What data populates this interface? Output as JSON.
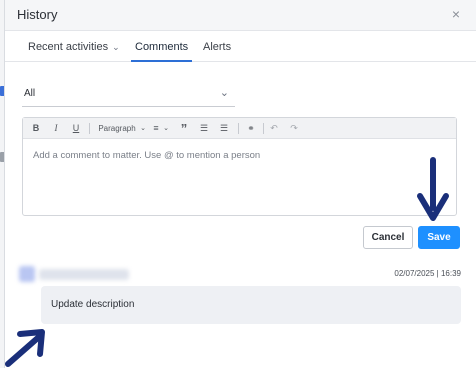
{
  "panel": {
    "title": "History",
    "close_icon": "×"
  },
  "tabs": [
    {
      "label": "Recent activities",
      "has_dropdown": true,
      "active": false
    },
    {
      "label": "Comments",
      "active": true
    },
    {
      "label": "Alerts",
      "active": false
    }
  ],
  "filter": {
    "value": "All"
  },
  "toolbar": {
    "bold": "B",
    "italic": "I",
    "underline": "U",
    "paragraph": "Paragraph",
    "align": "≡",
    "quote": "”",
    "ordered_list": "☰",
    "bullet_list": "☰",
    "link": "⚭",
    "undo": "↶",
    "redo": "↷"
  },
  "editor": {
    "placeholder": "Add a comment to matter. Use @ to mention a person"
  },
  "actions": {
    "cancel_label": "Cancel",
    "save_label": "Save"
  },
  "comment": {
    "timestamp": "02/07/2025 | 16:39",
    "text": "Update description"
  },
  "colors": {
    "accent": "#1e90ff",
    "tab_underline": "#2d6fd6",
    "annotation_arrow": "#1a2f7a"
  }
}
